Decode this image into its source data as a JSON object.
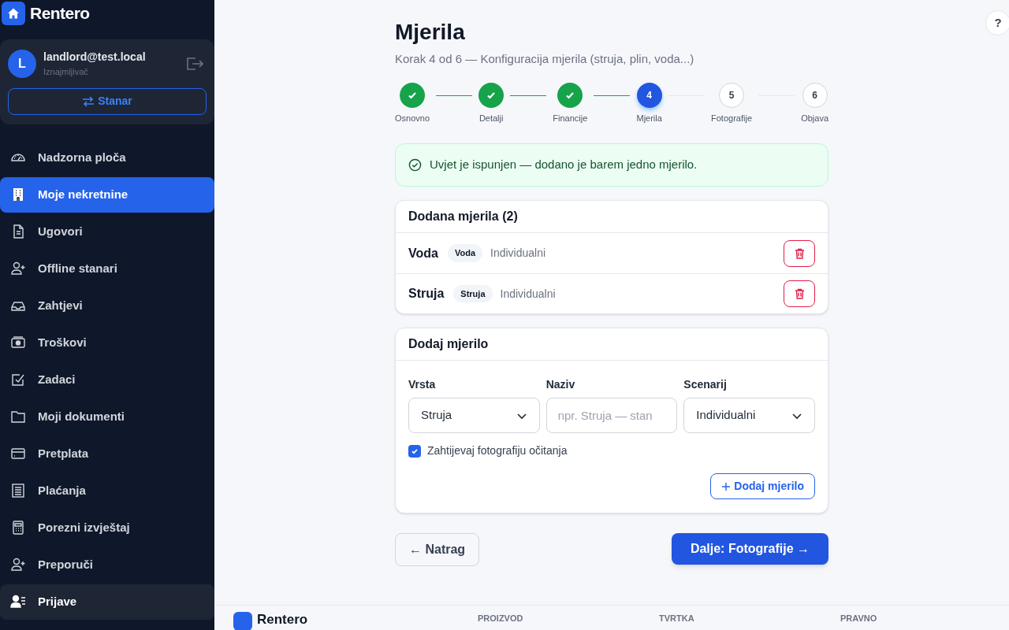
{
  "brand": "Rentero",
  "user": {
    "initial": "L",
    "email": "landlord@test.local",
    "role": "Iznajmljivač",
    "switch_button": "Stanar"
  },
  "sidebar": {
    "items": [
      {
        "label": "Nadzorna ploča",
        "kind": "gauge",
        "selected": false,
        "hovered": false
      },
      {
        "label": "Moje nekretnine",
        "kind": "building",
        "selected": true,
        "hovered": false
      },
      {
        "label": "Ugovori",
        "kind": "document",
        "selected": false,
        "hovered": false
      },
      {
        "label": "Offline stanari",
        "kind": "user-plus",
        "selected": false,
        "hovered": false
      },
      {
        "label": "Zahtjevi",
        "kind": "inbox",
        "selected": false,
        "hovered": false
      },
      {
        "label": "Troškovi",
        "kind": "cash",
        "selected": false,
        "hovered": false
      },
      {
        "label": "Zadaci",
        "kind": "check-square",
        "selected": false,
        "hovered": false
      },
      {
        "label": "Moji dokumenti",
        "kind": "folder",
        "selected": false,
        "hovered": false
      },
      {
        "label": "Pretplata",
        "kind": "card",
        "selected": false,
        "hovered": false
      },
      {
        "label": "Plaćanja",
        "kind": "receipt",
        "selected": false,
        "hovered": false
      },
      {
        "label": "Porezni izvještaj",
        "kind": "calculator",
        "selected": false,
        "hovered": false
      },
      {
        "label": "Preporuči",
        "kind": "user-plus",
        "selected": false,
        "hovered": false
      },
      {
        "label": "Prijave",
        "kind": "user-list",
        "selected": false,
        "hovered": true
      }
    ]
  },
  "help_button": "?",
  "page": {
    "title": "Mjerila",
    "subtitle": "Korak 4 od 6 — Konfiguracija mjerila (struja, plin, voda...)"
  },
  "steps": [
    {
      "label": "Osnovno",
      "kind": "done"
    },
    {
      "label": "Detalji",
      "kind": "done"
    },
    {
      "label": "Financije",
      "kind": "done"
    },
    {
      "number": "4",
      "label": "Mjerila",
      "kind": "current"
    },
    {
      "number": "5",
      "label": "Fotografije",
      "kind": "upcoming"
    },
    {
      "number": "6",
      "label": "Objava",
      "kind": "upcoming"
    }
  ],
  "alert": "Uvjet je ispunjen — dodano je barem jedno mjerilo.",
  "added_meters": {
    "title": "Dodana mjerila (2)",
    "rows": [
      {
        "name": "Voda",
        "type": "Voda",
        "scenario": "Individualni"
      },
      {
        "name": "Struja",
        "type": "Struja",
        "scenario": "Individualni"
      }
    ]
  },
  "add_meter": {
    "title": "Dodaj mjerilo",
    "type_field": {
      "label": "Vrsta",
      "value": "Struja"
    },
    "name_field": {
      "label": "Naziv",
      "placeholder": "npr. Struja — stan"
    },
    "scenario_field": {
      "label": "Scenarij",
      "value": "Individualni"
    },
    "photo_checkbox": {
      "label": "Zahtijevaj fotografiju očitanja",
      "checked": true
    },
    "add_button": "Dodaj mjerilo"
  },
  "back_button": "← Natrag",
  "next_button": "Dalje: Fotografije →",
  "footer": {
    "brand": "Rentero",
    "columns": [
      "PROIZVOD",
      "TVRTKA",
      "PRAVNO"
    ]
  }
}
